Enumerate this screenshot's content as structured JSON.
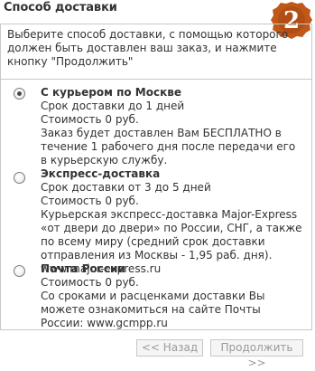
{
  "header": {
    "title": "Способ доставки",
    "step_number": "2"
  },
  "intro": {
    "text": "Выберите способ доставки, с помощью которого должен быть доставлен ваш заказ, и нажмите кнопку \"Продолжить\""
  },
  "options": [
    {
      "title": "С курьером по Москве",
      "lines": [
        "Срок доставки до 1 дней",
        "Стоимость 0 руб.",
        "Заказ будет доставлен Вам БЕСПЛАТНО в течение 1 рабочего дня после передачи его в курьерскую службу."
      ],
      "selected": true
    },
    {
      "title": "Экспресс-доставка",
      "lines": [
        "Срок доставки от 3 до 5 дней",
        "Стоимость 0 руб.",
        "Курьерская экспресс-доставка Major-Express «от двери до двери» по России, СНГ, а также по всему миру (средний срок доставки отправления из Москвы - 1,95 раб. дня). www.major-express.ru"
      ],
      "selected": false
    },
    {
      "title": "Почта России",
      "lines": [
        "Стоимость 0 руб.",
        "Со сроками и расценками доставки Вы можете ознакомиться на сайте Почты России: www.gcmpp.ru"
      ],
      "selected": false
    }
  ],
  "buttons": {
    "back_label": "<< Назад",
    "next_label": "Продолжить >>"
  },
  "colors": {
    "badge": "#c0581a",
    "border": "#c8c8c8",
    "disabled_text": "#9a9a9a"
  }
}
